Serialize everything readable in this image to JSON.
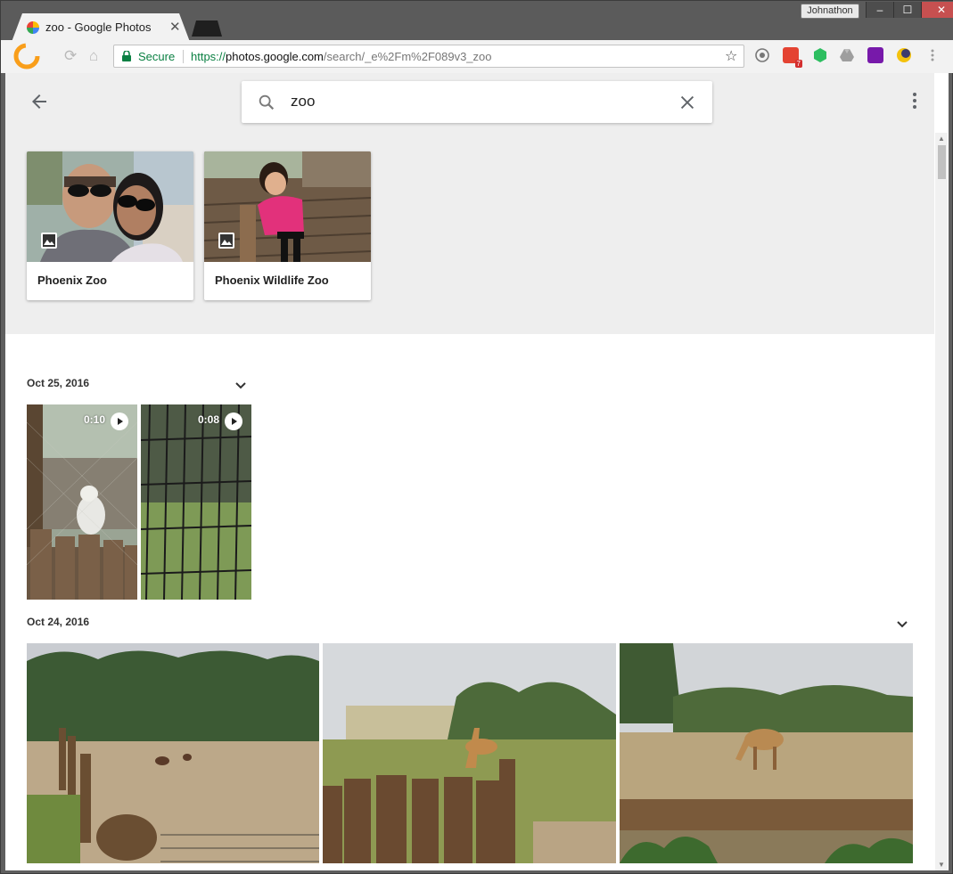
{
  "browser": {
    "tab_title": "zoo - Google Photos",
    "tab_close": "✕",
    "profile_name": "Johnathon",
    "minimize": "–",
    "maximize": "☐",
    "close": "✕",
    "secure_label": "Secure",
    "url_scheme": "https://",
    "url_host": "photos.google.com",
    "url_path": "/search/_e%2Fm%2F089v3_zoo",
    "bookmark_star": "☆",
    "extension_badge": "7"
  },
  "search": {
    "query": "zoo"
  },
  "albums": [
    {
      "label": "Phoenix Zoo"
    },
    {
      "label": "Phoenix Wildlife Zoo"
    }
  ],
  "sections": [
    {
      "date": "Oct 25, 2016",
      "videos": [
        {
          "duration": "0:10"
        },
        {
          "duration": "0:08"
        }
      ]
    },
    {
      "date": "Oct 24, 2016"
    }
  ],
  "colors": {
    "secure_green": "#0b8043",
    "header_gray": "#eeeeee"
  }
}
